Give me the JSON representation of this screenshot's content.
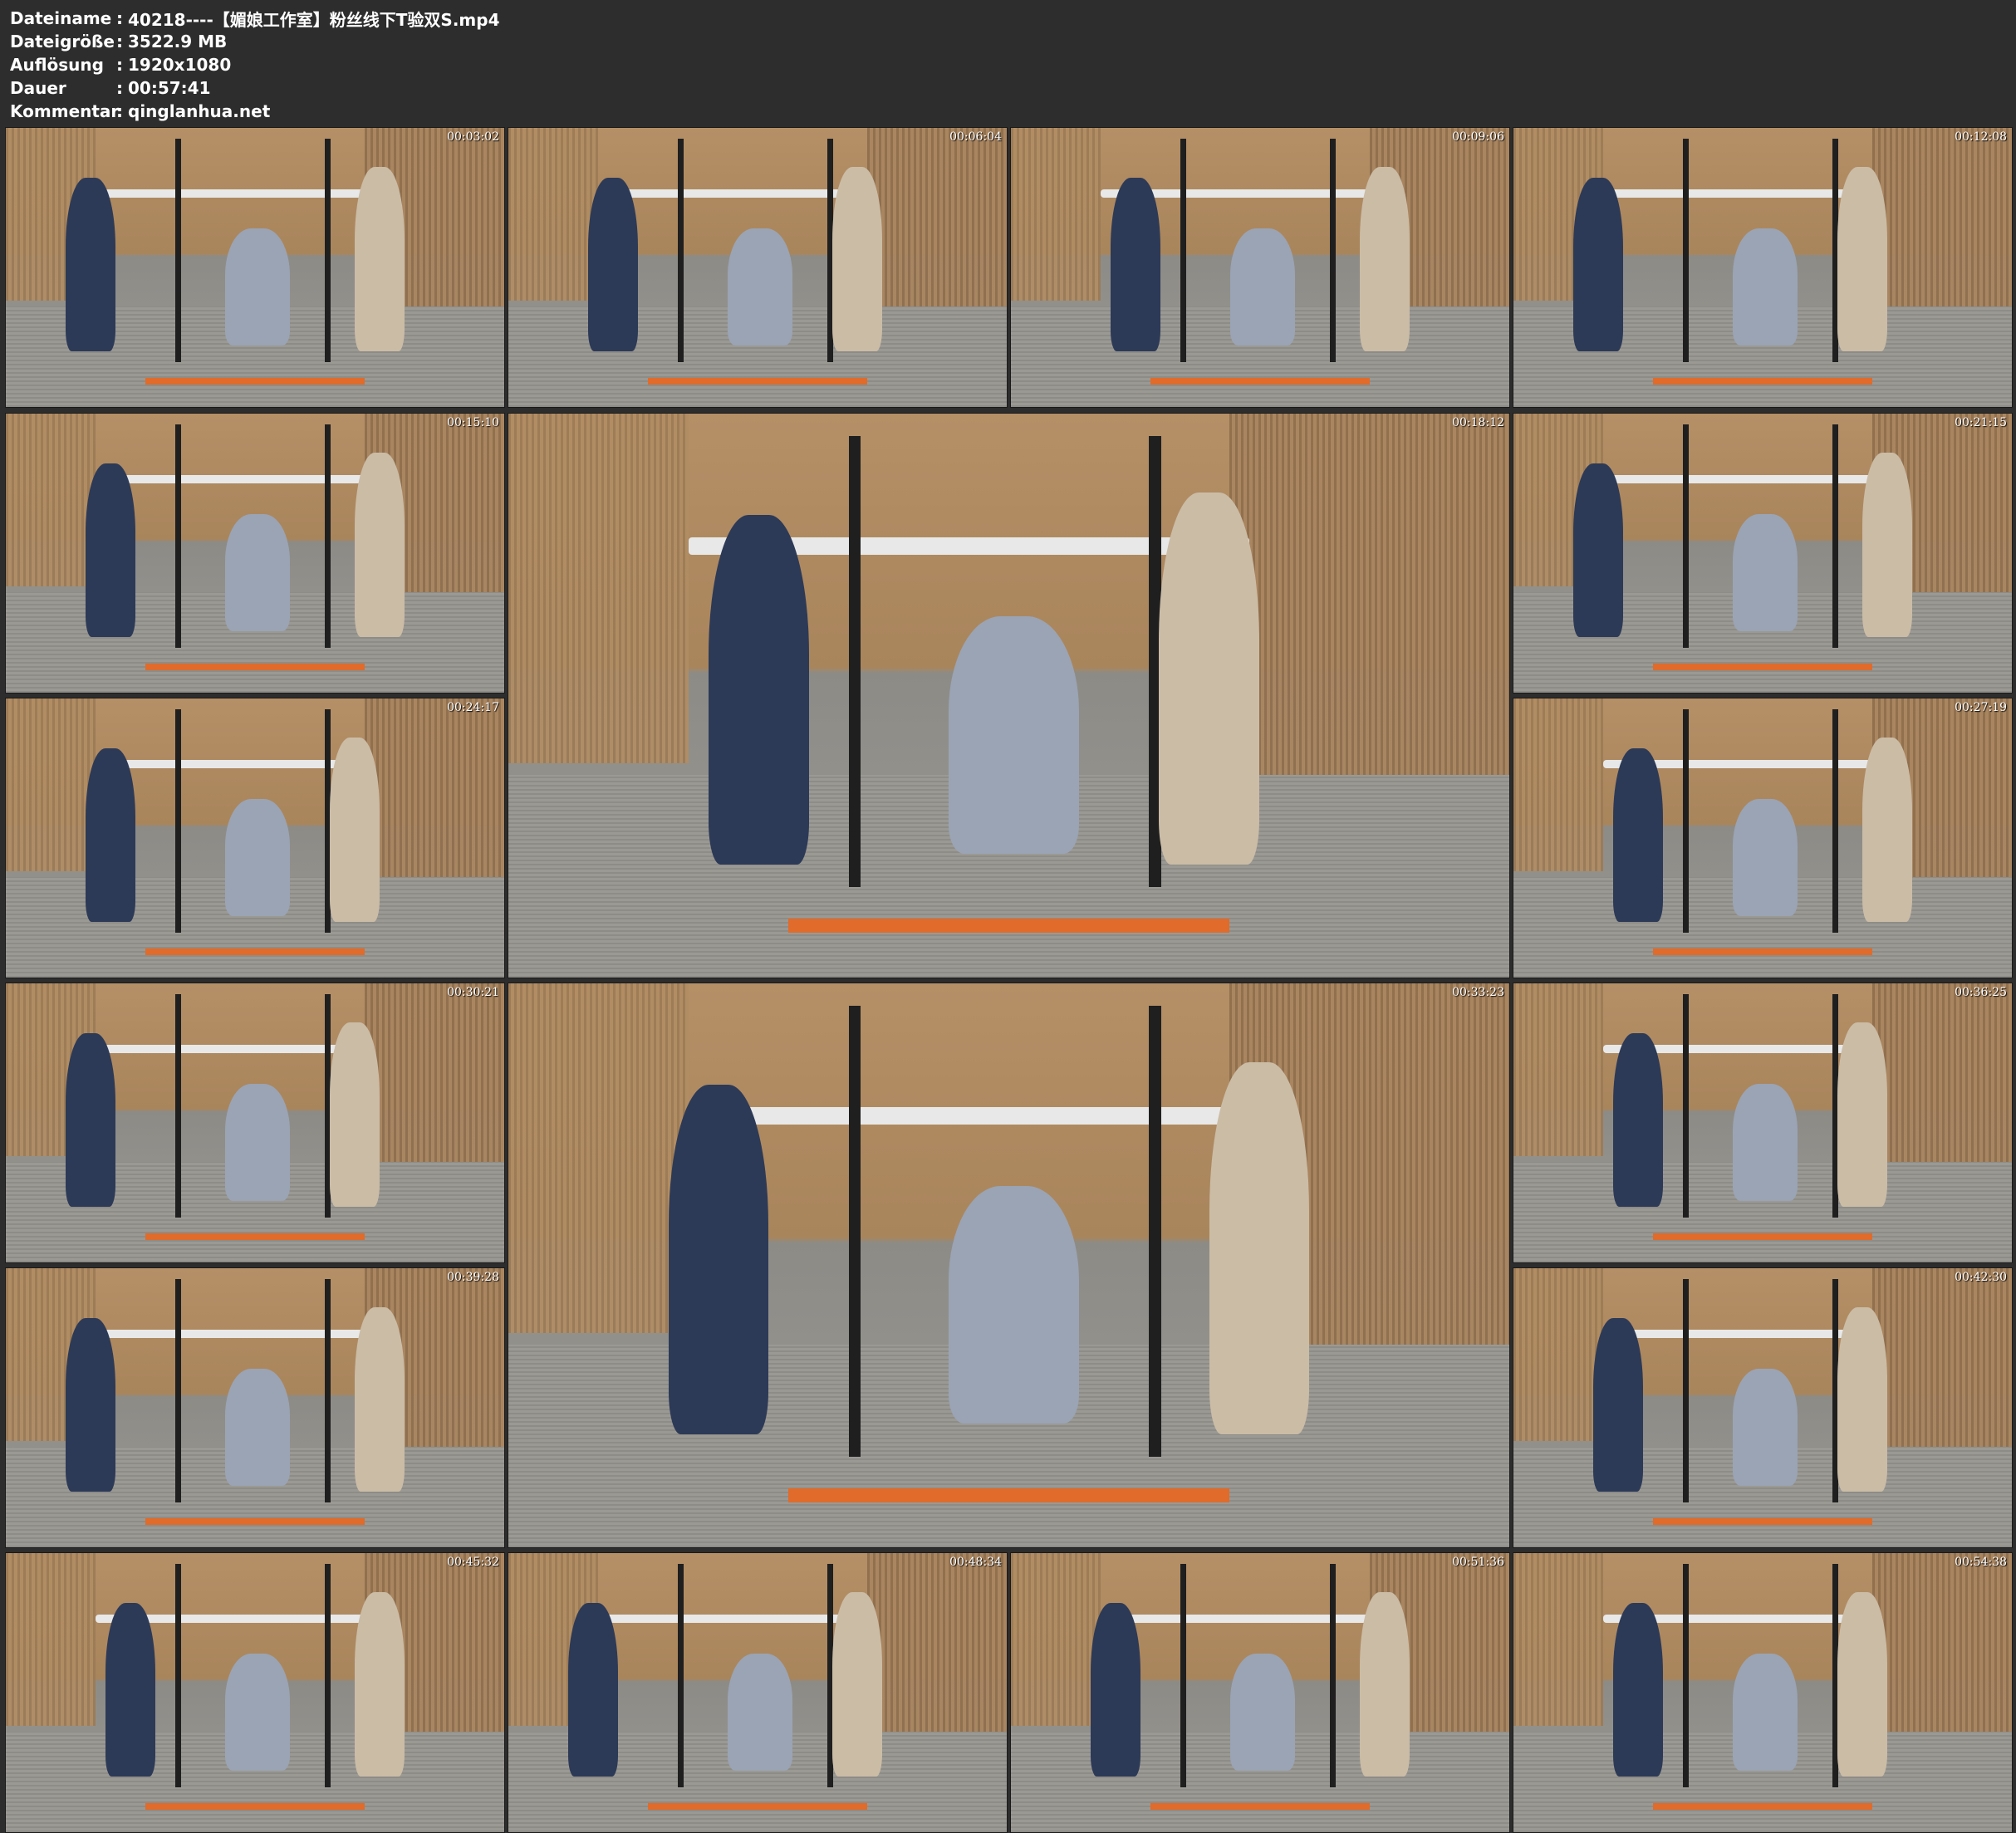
{
  "metadata": [
    {
      "label": "Dateiname",
      "value": "40218----【媚娘工作室】粉丝线下T验双S.mp4"
    },
    {
      "label": "Dateigröße",
      "value": "3522.9 MB"
    },
    {
      "label": "Auflösung",
      "value": "1920x1080"
    },
    {
      "label": "Dauer",
      "value": "00:57:41"
    },
    {
      "label": "Kommentar",
      "value": "qinglanhua.net"
    }
  ],
  "separator": ":",
  "thumbnails": [
    {
      "timestamp": "00:03:02"
    },
    {
      "timestamp": "00:06:04"
    },
    {
      "timestamp": "00:09:06"
    },
    {
      "timestamp": "00:12:08"
    },
    {
      "timestamp": "00:15:10"
    },
    {
      "timestamp": "00:18:12"
    },
    {
      "timestamp": "00:21:15"
    },
    {
      "timestamp": "00:24:17"
    },
    {
      "timestamp": "00:27:19"
    },
    {
      "timestamp": "00:30:21"
    },
    {
      "timestamp": "00:33:23"
    },
    {
      "timestamp": "00:36:25"
    },
    {
      "timestamp": "00:39:28"
    },
    {
      "timestamp": "00:42:30"
    },
    {
      "timestamp": "00:45:32"
    },
    {
      "timestamp": "00:48:34"
    },
    {
      "timestamp": "00:51:36"
    },
    {
      "timestamp": "00:54:38"
    }
  ]
}
